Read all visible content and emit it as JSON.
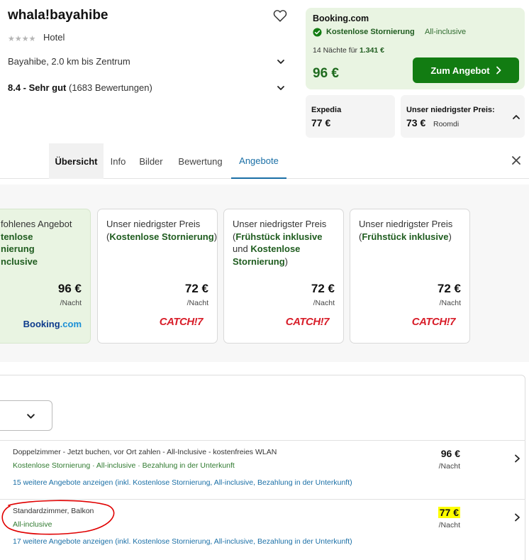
{
  "hotel": {
    "name": "whala!bayahibe",
    "stars": "★★★★",
    "type": "Hotel",
    "location": "Bayahibe, 2.0 km bis Zentrum",
    "rating_score": "8.4 - Sehr gut",
    "rating_count": "(1683 Bewertungen)"
  },
  "booking_card": {
    "provider": "Booking.com",
    "cancellation": "Kostenlose Stornierung",
    "board": "All-inclusive",
    "nights_text": "14 Nächte für",
    "nights_total": "1.341 €",
    "price": "96 €",
    "button_label": "Zum Angebot"
  },
  "side_cards": {
    "expedia": {
      "label": "Expedia",
      "price": "77 €"
    },
    "lowest": {
      "label": "Unser niedrigster Preis:",
      "price": "73 €",
      "source": "Roomdi"
    }
  },
  "tabs": [
    {
      "label": "Übersicht"
    },
    {
      "label": "Info"
    },
    {
      "label": "Bilder"
    },
    {
      "label": "Bewertung"
    },
    {
      "label": "Angebote"
    }
  ],
  "offers": [
    {
      "title_plain": "fohlenes Angebot",
      "title_bold_1": "tenlose",
      "title_bold_2": "nierung",
      "title_bold_3": "nclusive",
      "price": "96 €",
      "unit": "/Nacht",
      "logo_main": "Booking",
      "logo_suffix": ".com"
    },
    {
      "title_plain": "Unser niedrigster Preis",
      "open": "(",
      "bold": "Kostenlose Stornierung",
      "close": ")",
      "price": "72 €",
      "unit": "/Nacht",
      "logo": "CATCH!7"
    },
    {
      "title_plain": "Unser niedrigster Preis",
      "open": "(",
      "bold": "Frühstück inklusive",
      "mid": "und",
      "bold2": "Kostenlose Stornierung",
      "close": ")",
      "price": "72 €",
      "unit": "/Nacht",
      "logo": "CATCH!7"
    },
    {
      "title_plain": "Unser niedrigster Preis",
      "open": "(",
      "bold": "Frühstück inklusive",
      "close": ")",
      "price": "72 €",
      "unit": "/Nacht",
      "logo": "CATCH!7"
    }
  ],
  "rooms": [
    {
      "title": "Doppelzimmer - Jetzt buchen, vor Ort zahlen - All-Inclusive - kostenfreies WLAN",
      "tags": "Kostenlose Stornierung · All-inclusive · Bezahlung in der Unterkunft",
      "price": "96 €",
      "unit": "/Nacht",
      "more": "15 weitere Angebote anzeigen (inkl. Kostenlose Stornierung, All-inclusive, Bezahlung in der Unterkunft)"
    },
    {
      "title": "Standardzimmer, Balkon",
      "tags": "All-inclusive",
      "price": "77 €",
      "unit": "/Nacht",
      "more": "17 weitere Angebote anzeigen (inkl. Kostenlose Stornierung, All-inclusive, Bezahlung in der Unterkunft)"
    }
  ],
  "colors": {
    "accent_green": "#127c12",
    "tab_blue": "#1a6fa6",
    "annotation_red": "#e00000",
    "highlight": "#ffff00"
  }
}
